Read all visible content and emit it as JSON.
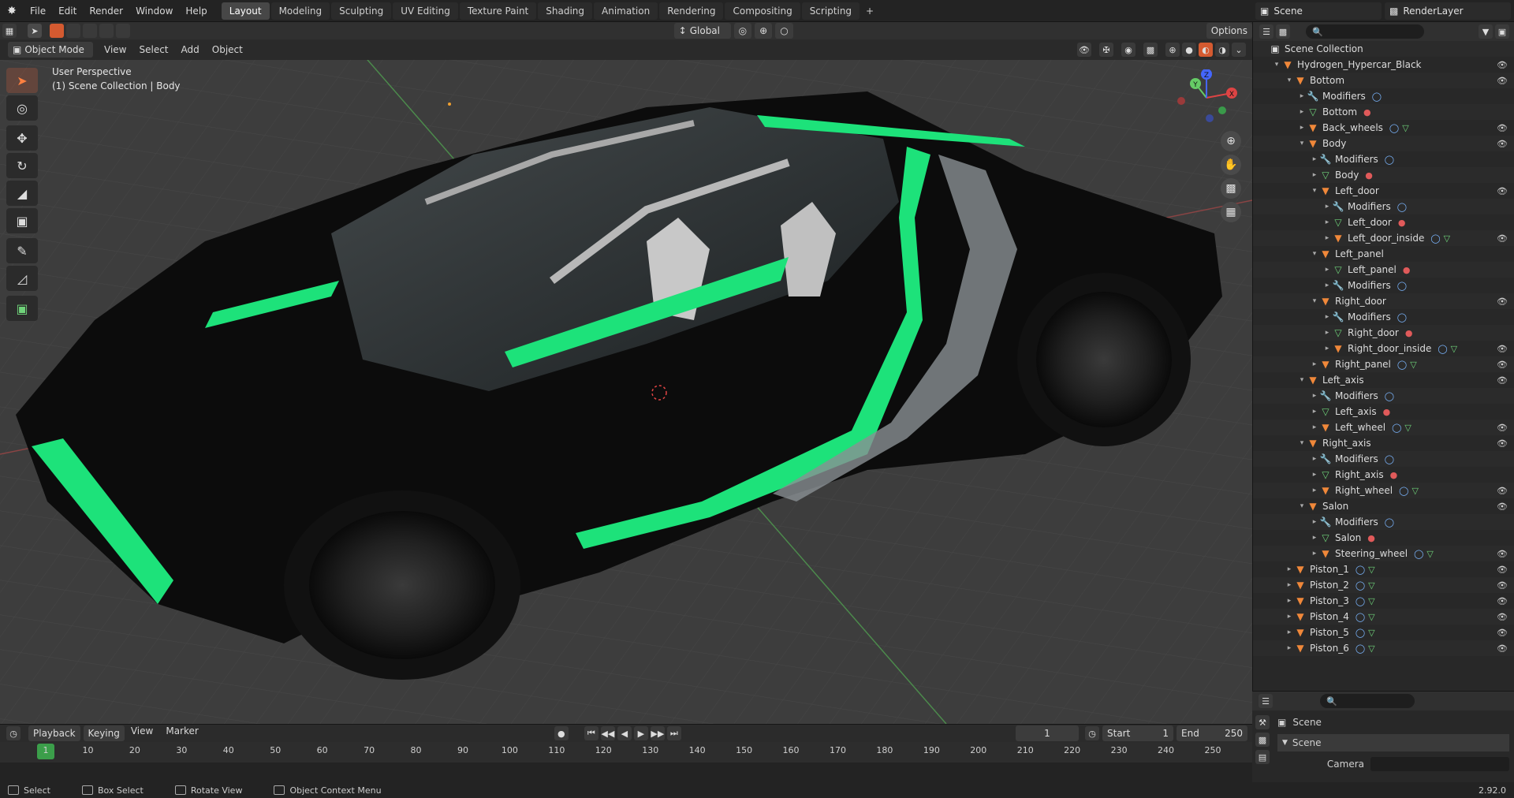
{
  "menubar": {
    "items": [
      "File",
      "Edit",
      "Render",
      "Window",
      "Help"
    ],
    "workspaces": [
      "Layout",
      "Modeling",
      "Sculpting",
      "UV Editing",
      "Texture Paint",
      "Shading",
      "Animation",
      "Rendering",
      "Compositing",
      "Scripting"
    ],
    "active_workspace": "Layout",
    "scene": "Scene",
    "view_layer": "RenderLayer"
  },
  "viewport_header": {
    "transform_orientation": "Global",
    "options_label": "Options",
    "mode": "Object Mode",
    "menus": [
      "View",
      "Select",
      "Add",
      "Object"
    ]
  },
  "viewport": {
    "perspective_label": "User Perspective",
    "context_label": "(1) Scene Collection | Body",
    "gizmo_axes": {
      "x": "X",
      "y": "Y",
      "z": "Z"
    }
  },
  "toolbar": {
    "tools": [
      "select-box",
      "cursor",
      "move",
      "rotate",
      "scale",
      "transform",
      "annotate",
      "measure",
      "add-cube"
    ]
  },
  "outliner": {
    "root": "Scene Collection",
    "rows": [
      {
        "label": "Hydrogen_Hypercar_Black",
        "indent": 1,
        "icon": "empty",
        "open": true,
        "eye": true
      },
      {
        "label": "Bottom",
        "indent": 2,
        "icon": "mesh",
        "open": true,
        "eye": true
      },
      {
        "label": "Modifiers",
        "indent": 3,
        "icon": "wrench",
        "open": false,
        "eye": false,
        "extra": "modifier"
      },
      {
        "label": "Bottom",
        "indent": 3,
        "icon": "mesh-data",
        "open": false,
        "eye": false,
        "extra": "material"
      },
      {
        "label": "Back_wheels",
        "indent": 3,
        "icon": "mesh",
        "open": false,
        "eye": true,
        "extra": "both"
      },
      {
        "label": "Body",
        "indent": 3,
        "icon": "mesh",
        "open": true,
        "eye": true
      },
      {
        "label": "Modifiers",
        "indent": 4,
        "icon": "wrench",
        "open": false,
        "eye": false,
        "extra": "modifier"
      },
      {
        "label": "Body",
        "indent": 4,
        "icon": "mesh-data",
        "open": false,
        "eye": false,
        "extra": "material"
      },
      {
        "label": "Left_door",
        "indent": 4,
        "icon": "mesh",
        "open": true,
        "eye": true
      },
      {
        "label": "Modifiers",
        "indent": 5,
        "icon": "wrench",
        "open": false,
        "eye": false,
        "extra": "modifier"
      },
      {
        "label": "Left_door",
        "indent": 5,
        "icon": "mesh-data",
        "open": false,
        "eye": false,
        "extra": "material"
      },
      {
        "label": "Left_door_inside",
        "indent": 5,
        "icon": "mesh",
        "open": false,
        "eye": true,
        "extra": "both"
      },
      {
        "label": "Left_panel",
        "indent": 4,
        "icon": "mesh",
        "open": true,
        "eye": false
      },
      {
        "label": "Left_panel",
        "indent": 5,
        "icon": "mesh-data",
        "open": false,
        "eye": false,
        "extra": "material"
      },
      {
        "label": "Modifiers",
        "indent": 5,
        "icon": "wrench",
        "open": false,
        "eye": false,
        "extra": "modifier"
      },
      {
        "label": "Right_door",
        "indent": 4,
        "icon": "mesh",
        "open": true,
        "eye": true
      },
      {
        "label": "Modifiers",
        "indent": 5,
        "icon": "wrench",
        "open": false,
        "eye": false,
        "extra": "modifier"
      },
      {
        "label": "Right_door",
        "indent": 5,
        "icon": "mesh-data",
        "open": false,
        "eye": false,
        "extra": "material"
      },
      {
        "label": "Right_door_inside",
        "indent": 5,
        "icon": "mesh",
        "open": false,
        "eye": true,
        "extra": "both"
      },
      {
        "label": "Right_panel",
        "indent": 4,
        "icon": "mesh",
        "open": false,
        "eye": true,
        "extra": "both"
      },
      {
        "label": "Left_axis",
        "indent": 3,
        "icon": "mesh",
        "open": true,
        "eye": true
      },
      {
        "label": "Modifiers",
        "indent": 4,
        "icon": "wrench",
        "open": false,
        "eye": false,
        "extra": "modifier"
      },
      {
        "label": "Left_axis",
        "indent": 4,
        "icon": "mesh-data",
        "open": false,
        "eye": false,
        "extra": "material"
      },
      {
        "label": "Left_wheel",
        "indent": 4,
        "icon": "mesh",
        "open": false,
        "eye": true,
        "extra": "both"
      },
      {
        "label": "Right_axis",
        "indent": 3,
        "icon": "mesh",
        "open": true,
        "eye": true
      },
      {
        "label": "Modifiers",
        "indent": 4,
        "icon": "wrench",
        "open": false,
        "eye": false,
        "extra": "modifier"
      },
      {
        "label": "Right_axis",
        "indent": 4,
        "icon": "mesh-data",
        "open": false,
        "eye": false,
        "extra": "material"
      },
      {
        "label": "Right_wheel",
        "indent": 4,
        "icon": "mesh",
        "open": false,
        "eye": true,
        "extra": "both"
      },
      {
        "label": "Salon",
        "indent": 3,
        "icon": "mesh",
        "open": true,
        "eye": true
      },
      {
        "label": "Modifiers",
        "indent": 4,
        "icon": "wrench",
        "open": false,
        "eye": false,
        "extra": "modifier"
      },
      {
        "label": "Salon",
        "indent": 4,
        "icon": "mesh-data",
        "open": false,
        "eye": false,
        "extra": "material"
      },
      {
        "label": "Steering_wheel",
        "indent": 4,
        "icon": "mesh",
        "open": false,
        "eye": true,
        "extra": "both"
      },
      {
        "label": "Piston_1",
        "indent": 2,
        "icon": "mesh",
        "open": false,
        "eye": true,
        "extra": "both"
      },
      {
        "label": "Piston_2",
        "indent": 2,
        "icon": "mesh",
        "open": false,
        "eye": true,
        "extra": "both"
      },
      {
        "label": "Piston_3",
        "indent": 2,
        "icon": "mesh",
        "open": false,
        "eye": true,
        "extra": "both"
      },
      {
        "label": "Piston_4",
        "indent": 2,
        "icon": "mesh",
        "open": false,
        "eye": true,
        "extra": "both"
      },
      {
        "label": "Piston_5",
        "indent": 2,
        "icon": "mesh",
        "open": false,
        "eye": true,
        "extra": "both"
      },
      {
        "label": "Piston_6",
        "indent": 2,
        "icon": "mesh",
        "open": false,
        "eye": true,
        "extra": "both"
      }
    ]
  },
  "properties": {
    "scene_label": "Scene",
    "panel_label": "Scene",
    "camera_label": "Camera"
  },
  "timeline": {
    "menus": [
      "Playback",
      "Keying",
      "View",
      "Marker"
    ],
    "current_frame": "1",
    "start_label": "Start",
    "start": "1",
    "end_label": "End",
    "end": "250",
    "ruler": [
      "1",
      "10",
      "20",
      "30",
      "40",
      "50",
      "60",
      "70",
      "80",
      "90",
      "100",
      "110",
      "120",
      "130",
      "140",
      "150",
      "160",
      "170",
      "180",
      "190",
      "200",
      "210",
      "220",
      "230",
      "240",
      "250"
    ]
  },
  "statusbar": {
    "items": [
      "Select",
      "Box Select",
      "Rotate View",
      "Object Context Menu"
    ],
    "version": "2.92.0"
  },
  "colors": {
    "accent_green": "#1de27a",
    "orange": "#f0883a",
    "active_tab": "#474747"
  }
}
